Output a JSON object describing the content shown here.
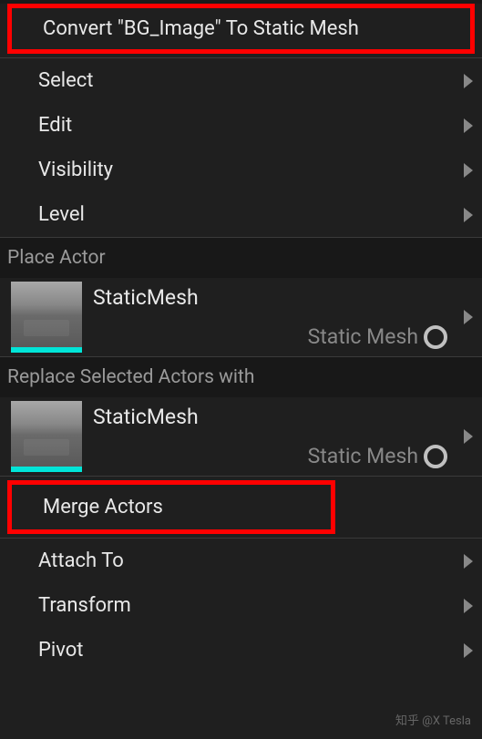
{
  "topAction": "Convert \"BG_Image\" To Static Mesh",
  "submenus": {
    "select": "Select",
    "edit": "Edit",
    "visibility": "Visibility",
    "level": "Level"
  },
  "placeActor": {
    "header": "Place Actor",
    "title": "StaticMesh",
    "typeLabel": "Static Mesh"
  },
  "replaceActors": {
    "header": "Replace Selected Actors with",
    "title": "StaticMesh",
    "typeLabel": "Static Mesh"
  },
  "mergeActors": "Merge Actors",
  "bottomMenus": {
    "attachTo": "Attach To",
    "transform": "Transform",
    "pivot": "Pivot"
  },
  "watermark": "知乎 @X Tesla"
}
